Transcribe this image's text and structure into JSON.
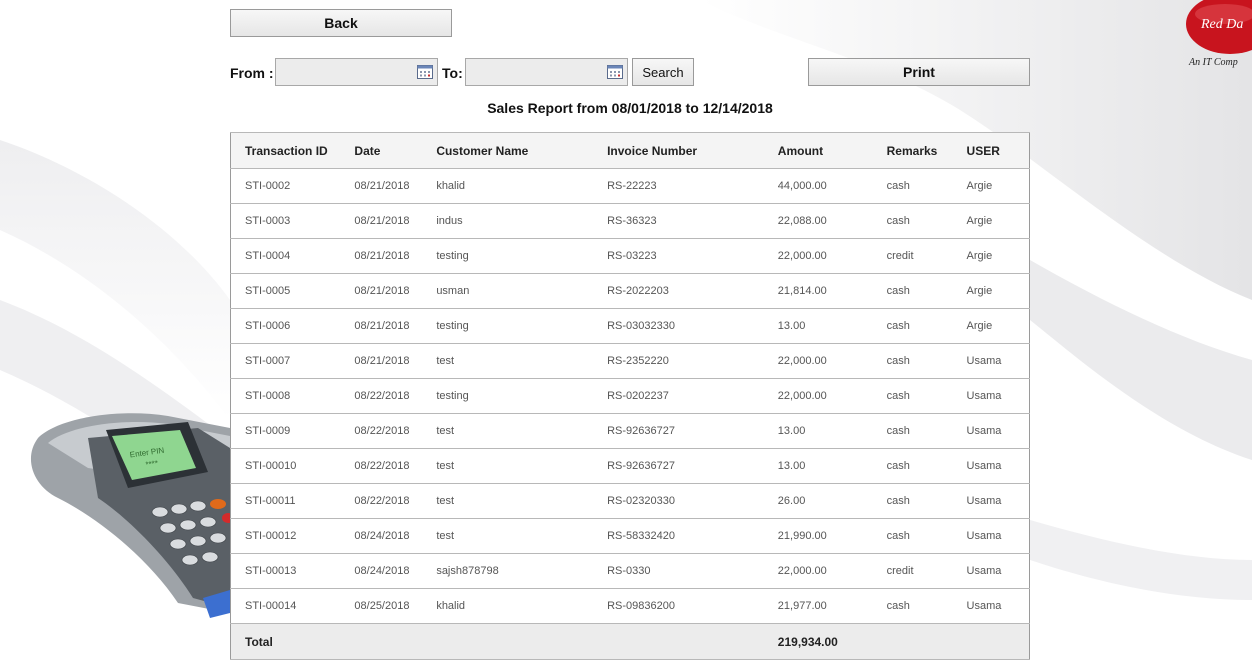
{
  "toolbar": {
    "back_label": "Back",
    "from_label": "From :",
    "to_label": "To:",
    "from_value": "",
    "to_value": "",
    "search_label": "Search",
    "print_label": "Print"
  },
  "report": {
    "title": "Sales Report from 08/01/2018 to 12/14/2018",
    "columns": [
      "Transaction ID",
      "Date",
      "Customer Name",
      "Invoice Number",
      "Amount",
      "Remarks",
      "USER"
    ],
    "rows": [
      [
        "STI-0002",
        "08/21/2018",
        "khalid",
        "RS-22223",
        "44,000.00",
        "cash",
        "Argie"
      ],
      [
        "STI-0003",
        "08/21/2018",
        "indus",
        "RS-36323",
        "22,088.00",
        "cash",
        "Argie"
      ],
      [
        "STI-0004",
        "08/21/2018",
        "testing",
        "RS-03223",
        "22,000.00",
        "credit",
        "Argie"
      ],
      [
        "STI-0005",
        "08/21/2018",
        "usman",
        "RS-2022203",
        "21,814.00",
        "cash",
        "Argie"
      ],
      [
        "STI-0006",
        "08/21/2018",
        "testing",
        "RS-03032330",
        "13.00",
        "cash",
        "Argie"
      ],
      [
        "STI-0007",
        "08/21/2018",
        "test",
        "RS-2352220",
        "22,000.00",
        "cash",
        "Usama"
      ],
      [
        "STI-0008",
        "08/22/2018",
        "testing",
        "RS-0202237",
        "22,000.00",
        "cash",
        "Usama"
      ],
      [
        "STI-0009",
        "08/22/2018",
        "test",
        "RS-92636727",
        "13.00",
        "cash",
        "Usama"
      ],
      [
        "STI-00010",
        "08/22/2018",
        "test",
        "RS-92636727",
        "13.00",
        "cash",
        "Usama"
      ],
      [
        "STI-00011",
        "08/22/2018",
        "test",
        "RS-02320330",
        "26.00",
        "cash",
        "Usama"
      ],
      [
        "STI-00012",
        "08/24/2018",
        "test",
        "RS-58332420",
        "21,990.00",
        "cash",
        "Usama"
      ],
      [
        "STI-00013",
        "08/24/2018",
        "sajsh878798",
        "RS-0330",
        "22,000.00",
        "credit",
        "Usama"
      ],
      [
        "STI-00014",
        "08/25/2018",
        "khalid",
        "RS-09836200",
        "21,977.00",
        "cash",
        "Usama"
      ]
    ],
    "total_label": "Total",
    "total_amount": "219,934.00"
  },
  "logo": {
    "text": "Red Da",
    "tagline": "An IT Comp",
    "color": "#c8141e"
  },
  "terminal": {
    "screen_text": "Enter PIN",
    "pin_mask": "****"
  },
  "icons": {
    "calendar": "calendar-icon"
  }
}
